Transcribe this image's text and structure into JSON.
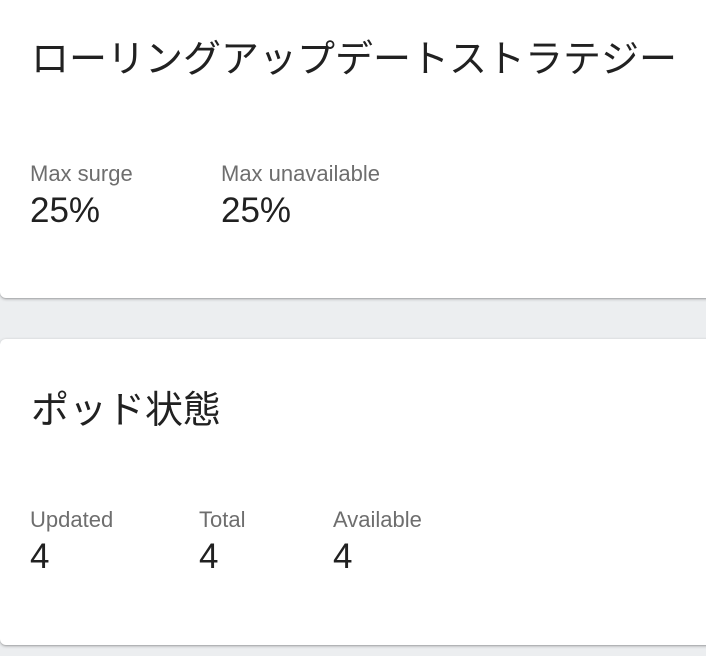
{
  "rolling_update_strategy": {
    "title": "ローリングアップデートストラテジー",
    "max_surge": {
      "label": "Max surge",
      "value": "25%"
    },
    "max_unavailable": {
      "label": "Max unavailable",
      "value": "25%"
    }
  },
  "pod_status": {
    "title": "ポッド状態",
    "updated": {
      "label": "Updated",
      "value": "4"
    },
    "total": {
      "label": "Total",
      "value": "4"
    },
    "available": {
      "label": "Available",
      "value": "4"
    }
  }
}
